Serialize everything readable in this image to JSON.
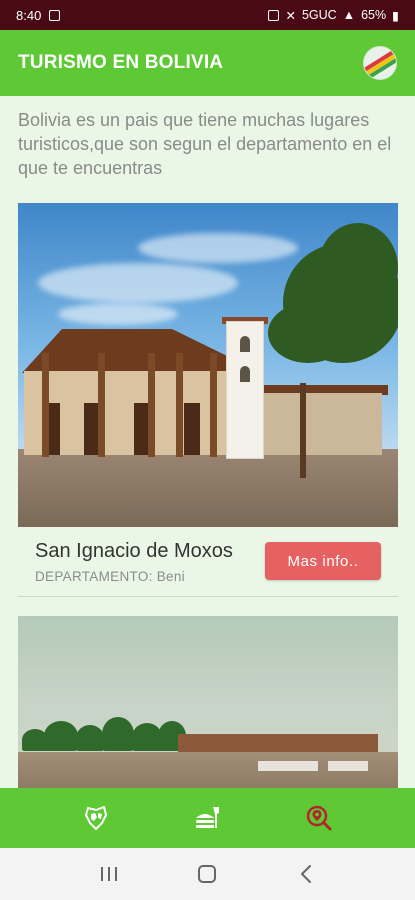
{
  "status_bar": {
    "time": "8:40",
    "network": "5GUC",
    "battery": "65%"
  },
  "app_bar": {
    "title": "TURISMO EN BOLIVIA",
    "logo_icon": "bolivia-flag-logo-icon"
  },
  "intro_text": "Bolivia es un pais que tiene muchas lugares turisticos,que son segun el departamento en el que te encuentras",
  "places": [
    {
      "name": "San Ignacio de Moxos",
      "department_label": "DEPARTAMENTO: Beni",
      "button_label": "Mas info.."
    }
  ],
  "bottom_nav": {
    "items": [
      {
        "icon": "map-region-icon"
      },
      {
        "icon": "food-icon"
      },
      {
        "icon": "location-search-icon",
        "active": true
      }
    ]
  },
  "colors": {
    "status_bar": "#4a0a14",
    "primary_green": "#5fc935",
    "background": "#eaf7e6",
    "button_red": "#e66262",
    "active_icon": "#b0262c"
  }
}
